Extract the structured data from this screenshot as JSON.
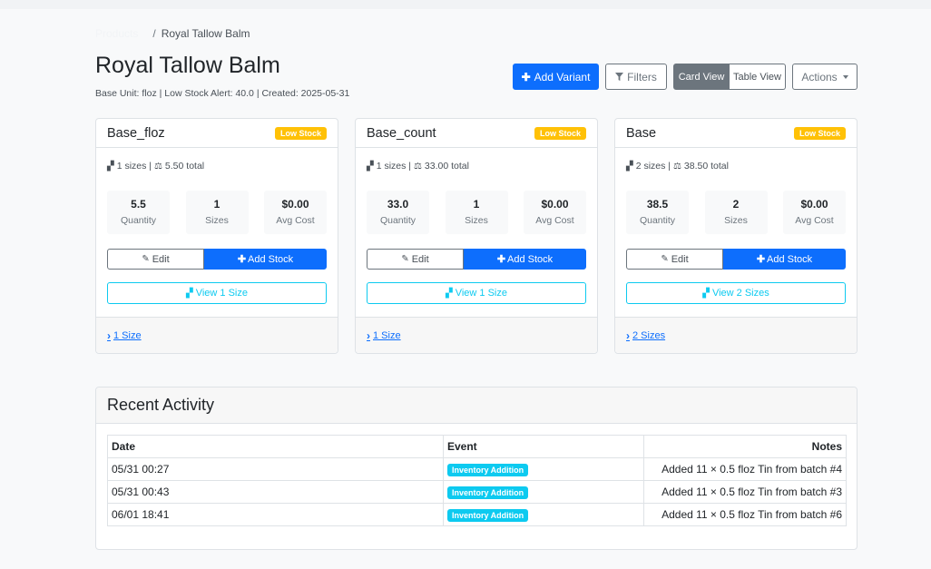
{
  "breadcrumb": {
    "root": "Products",
    "separator": "/",
    "current": "Royal Tallow Balm"
  },
  "page": {
    "title": "Royal Tallow Balm",
    "meta": "Base Unit: floz | Low Stock Alert: 40.0 | Created: 2025-05-31"
  },
  "toolbar": {
    "add_variant": "Add Variant",
    "filters": "Filters",
    "card_view": "Card View",
    "table_view": "Table View",
    "actions": "Actions"
  },
  "cards": [
    {
      "title": "Base_floz",
      "badge": "Low Stock",
      "sizes_text": "1 sizes",
      "total_text": "5.50 total",
      "stats": [
        {
          "value": "5.5",
          "label": "Quantity"
        },
        {
          "value": "1",
          "label": "Sizes"
        },
        {
          "value": "$0.00",
          "label": "Avg Cost"
        }
      ],
      "edit": "Edit",
      "add_stock": "Add Stock",
      "view": "View 1 Size",
      "footer": "1 Size"
    },
    {
      "title": "Base_count",
      "badge": "Low Stock",
      "sizes_text": "1 sizes",
      "total_text": "33.00 total",
      "stats": [
        {
          "value": "33.0",
          "label": "Quantity"
        },
        {
          "value": "1",
          "label": "Sizes"
        },
        {
          "value": "$0.00",
          "label": "Avg Cost"
        }
      ],
      "edit": "Edit",
      "add_stock": "Add Stock",
      "view": "View 1 Size",
      "footer": "1 Size"
    },
    {
      "title": "Base",
      "badge": "Low Stock",
      "sizes_text": "2 sizes",
      "total_text": "38.50 total",
      "stats": [
        {
          "value": "38.5",
          "label": "Quantity"
        },
        {
          "value": "2",
          "label": "Sizes"
        },
        {
          "value": "$0.00",
          "label": "Avg Cost"
        }
      ],
      "edit": "Edit",
      "add_stock": "Add Stock",
      "view": "View 2 Sizes",
      "footer": "2 Sizes"
    }
  ],
  "activity": {
    "title": "Recent Activity",
    "columns": [
      "Date",
      "Event",
      "Notes"
    ],
    "rows": [
      {
        "date": "05/31 00:27",
        "event": "Inventory Addition",
        "notes": "Added 11 × 0.5 floz Tin from batch #4"
      },
      {
        "date": "05/31 00:43",
        "event": "Inventory Addition",
        "notes": "Added 11 × 0.5 floz Tin from batch #3"
      },
      {
        "date": "06/01 18:41",
        "event": "Inventory Addition",
        "notes": "Added 11 × 0.5 floz Tin from batch #6"
      }
    ]
  },
  "colors": {
    "primary": "#0d6efd",
    "warning": "#ffc107",
    "info": "#0dcaf0",
    "secondary": "#6c757d"
  },
  "icons": {
    "add": "plus-icon",
    "filter": "filter-icon",
    "sizes": "boxes-icon",
    "total": "scale-icon",
    "edit": "edit-icon",
    "chevron": "chevron-right-icon"
  }
}
